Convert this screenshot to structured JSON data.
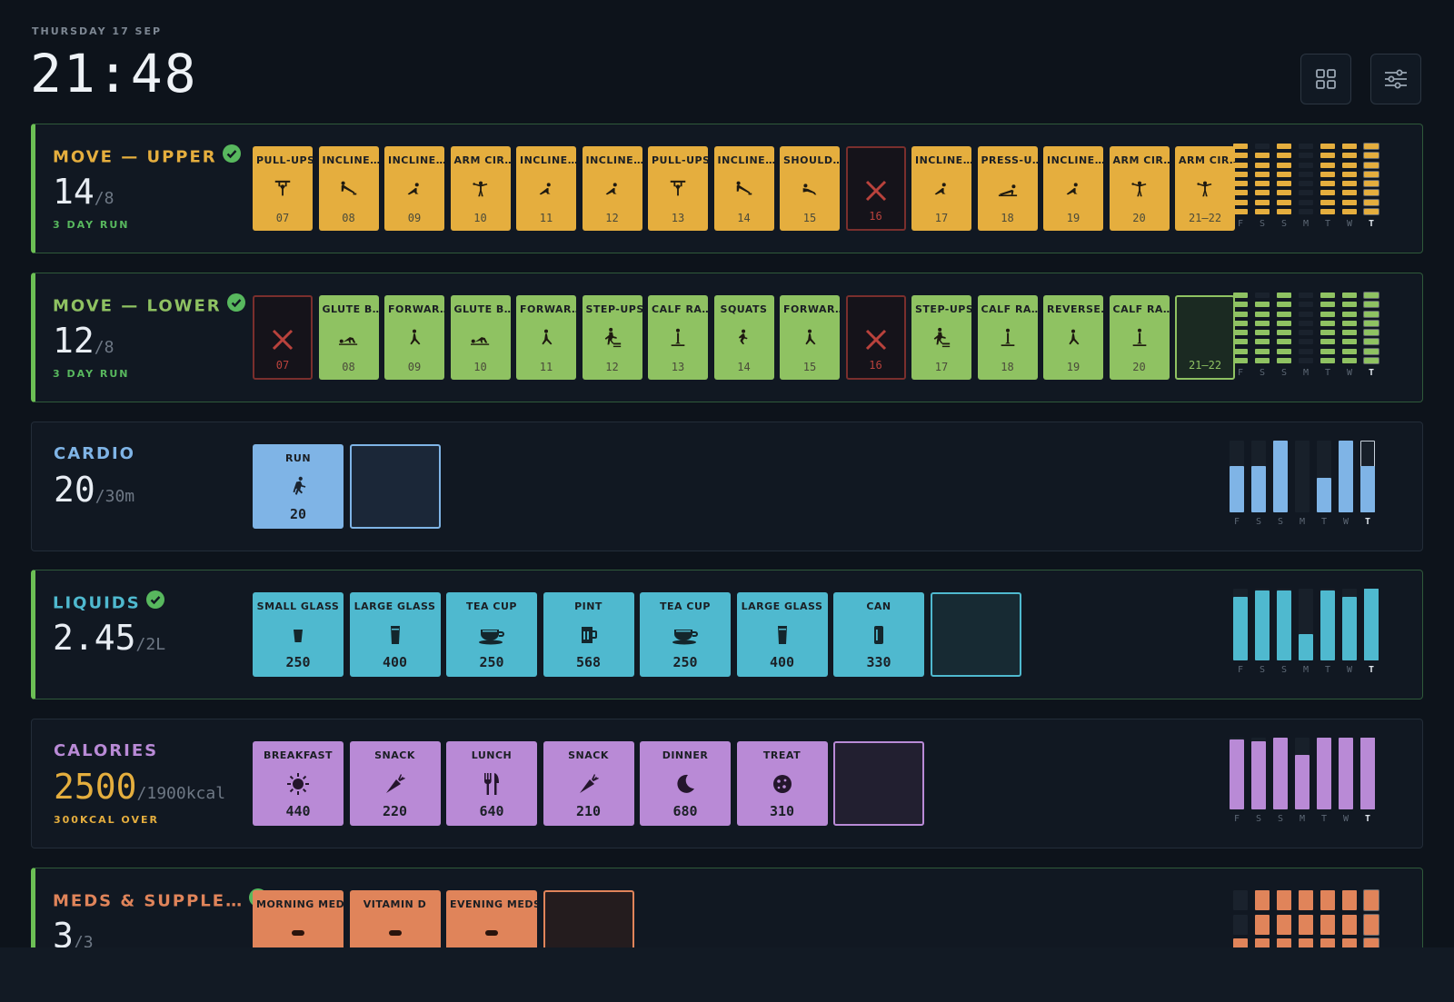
{
  "header": {
    "date": "THURSDAY 17 SEP",
    "time": "21:48"
  },
  "toolbar": {
    "grid_icon": "grid-icon",
    "settings_icon": "sliders-icon"
  },
  "days": [
    "F",
    "S",
    "S",
    "M",
    "T",
    "W",
    "T"
  ],
  "sections": [
    {
      "id": "move-upper",
      "title": "MOVE — UPPER",
      "complete": true,
      "value": "14",
      "goal": "/8",
      "sub": "3 DAY RUN",
      "color": "#e5ae3e",
      "title_color": "#e5ae3e",
      "sub_color": "#58b85e",
      "tiles": [
        {
          "label": "PULL-UPS",
          "icon": "pullup-icon",
          "value": "07"
        },
        {
          "label": "INCLINE…",
          "icon": "incline-pushup-icon",
          "value": "08"
        },
        {
          "label": "INCLINE…",
          "icon": "incline-icon",
          "value": "09"
        },
        {
          "label": "ARM CIR…",
          "icon": "arm-circles-icon",
          "value": "10"
        },
        {
          "label": "INCLINE…",
          "icon": "incline-icon",
          "value": "11"
        },
        {
          "label": "INCLINE…",
          "icon": "incline-icon",
          "value": "12"
        },
        {
          "label": "PULL-UPS",
          "icon": "pullup-icon",
          "value": "13"
        },
        {
          "label": "INCLINE…",
          "icon": "incline-pushup-icon",
          "value": "14"
        },
        {
          "label": "SHOULD…",
          "icon": "shoulder-icon",
          "value": "15"
        },
        {
          "missed": true,
          "value": "16"
        },
        {
          "label": "INCLINE…",
          "icon": "incline-icon",
          "value": "17"
        },
        {
          "label": "PRESS-U…",
          "icon": "pressup-icon",
          "value": "18"
        },
        {
          "label": "INCLINE…",
          "icon": "incline-icon",
          "value": "19"
        },
        {
          "label": "ARM CIR…",
          "icon": "arm-circles-icon",
          "value": "20"
        },
        {
          "label": "ARM CIR…",
          "icon": "arm-circles-icon",
          "value": "21–22"
        }
      ],
      "spark": {
        "type": "segments",
        "max": 8,
        "values": [
          8,
          7,
          8,
          0,
          8,
          8,
          8
        ]
      }
    },
    {
      "id": "move-lower",
      "title": "MOVE — LOWER",
      "complete": true,
      "value": "12",
      "goal": "/8",
      "sub": "3 DAY RUN",
      "color": "#8fc262",
      "title_color": "#8fc262",
      "sub_color": "#58b85e",
      "tiles": [
        {
          "missed": true,
          "value": "07"
        },
        {
          "label": "GLUTE B…",
          "icon": "glute-bridge-icon",
          "value": "08"
        },
        {
          "label": "FORWAR…",
          "icon": "lunge-icon",
          "value": "09"
        },
        {
          "label": "GLUTE B…",
          "icon": "glute-bridge-icon",
          "value": "10"
        },
        {
          "label": "FORWAR…",
          "icon": "lunge-icon",
          "value": "11"
        },
        {
          "label": "STEP-UPS",
          "icon": "step-up-icon",
          "value": "12"
        },
        {
          "label": "CALF RA…",
          "icon": "calf-raise-icon",
          "value": "13"
        },
        {
          "label": "SQUATS",
          "icon": "squat-icon",
          "value": "14"
        },
        {
          "label": "FORWAR…",
          "icon": "lunge-icon",
          "value": "15"
        },
        {
          "missed": true,
          "value": "16"
        },
        {
          "label": "STEP-UPS",
          "icon": "step-up-icon",
          "value": "17"
        },
        {
          "label": "CALF RA…",
          "icon": "calf-raise-icon",
          "value": "18"
        },
        {
          "label": "REVERSE…",
          "icon": "lunge-icon",
          "value": "19"
        },
        {
          "label": "CALF RA…",
          "icon": "calf-raise-icon",
          "value": "20"
        },
        {
          "empty": true,
          "value": "21–22"
        }
      ],
      "spark": {
        "type": "segments",
        "max": 8,
        "values": [
          8,
          7,
          8,
          0,
          8,
          8,
          8
        ]
      }
    },
    {
      "id": "cardio",
      "title": "CARDIO",
      "complete": false,
      "value": "20",
      "goal": "/30m",
      "sub": "",
      "color": "#7fb4e6",
      "title_color": "#7fb4e6",
      "sub_color": "#7fb4e6",
      "tiles": [
        {
          "label": "RUN",
          "icon": "run-icon",
          "value": "20"
        },
        {
          "empty": true,
          "value": ""
        }
      ],
      "spark": {
        "type": "bars",
        "values": [
          0.65,
          0.65,
          1.0,
          0,
          0.48,
          1.0,
          0.65
        ]
      }
    },
    {
      "id": "liquids",
      "title": "LIQUIDS",
      "complete": true,
      "value": "2.45",
      "goal": "/2L",
      "sub": "",
      "color": "#4fb9cf",
      "title_color": "#4fb9cf",
      "sub_color": "#4fb9cf",
      "tiles": [
        {
          "label": "SMALL GLASS",
          "icon": "small-glass-icon",
          "value": "250"
        },
        {
          "label": "LARGE GLASS",
          "icon": "large-glass-icon",
          "value": "400"
        },
        {
          "label": "TEA CUP",
          "icon": "tea-cup-icon",
          "value": "250"
        },
        {
          "label": "PINT",
          "icon": "pint-icon",
          "value": "568"
        },
        {
          "label": "TEA CUP",
          "icon": "tea-cup-icon",
          "value": "250"
        },
        {
          "label": "LARGE GLASS",
          "icon": "large-glass-icon",
          "value": "400"
        },
        {
          "label": "CAN",
          "icon": "can-icon",
          "value": "330"
        },
        {
          "empty": true,
          "value": ""
        }
      ],
      "spark": {
        "type": "bars",
        "values": [
          0.88,
          0.98,
          0.98,
          0.37,
          0.97,
          0.88,
          1.0
        ]
      }
    },
    {
      "id": "calories",
      "title": "CALORIES",
      "complete": false,
      "value": "2500",
      "goal": "/1900kcal",
      "sub": "300KCAL OVER",
      "color": "#b98ad6",
      "title_color": "#b98ad6",
      "sub_color": "#e5ae3e",
      "value_color": "#e5ae3e",
      "tiles": [
        {
          "label": "BREAKFAST",
          "icon": "sun-icon",
          "value": "440"
        },
        {
          "label": "SNACK",
          "icon": "carrot-icon",
          "value": "220"
        },
        {
          "label": "LUNCH",
          "icon": "fork-knife-icon",
          "value": "640"
        },
        {
          "label": "SNACK",
          "icon": "carrot-icon",
          "value": "210"
        },
        {
          "label": "DINNER",
          "icon": "moon-icon",
          "value": "680"
        },
        {
          "label": "TREAT",
          "icon": "cookie-icon",
          "value": "310"
        },
        {
          "empty": true,
          "value": ""
        }
      ],
      "spark": {
        "type": "bars",
        "values": [
          0.98,
          0.95,
          1.0,
          0.76,
          1.0,
          1.0,
          1.0
        ]
      }
    },
    {
      "id": "meds",
      "title": "MEDS & SUPPLE…",
      "complete": true,
      "value": "3",
      "goal": "/3",
      "sub": "",
      "color": "#e0845a",
      "title_color": "#e0845a",
      "sub_color": "#58b85e",
      "tiles": [
        {
          "label": "MORNING MEDS",
          "icon": "pill-icon",
          "value": ""
        },
        {
          "label": "VITAMIN D",
          "icon": "pill-icon",
          "value": ""
        },
        {
          "label": "EVENING MEDS",
          "icon": "pill-icon",
          "value": ""
        },
        {
          "empty": true,
          "value": ""
        }
      ],
      "spark": {
        "type": "segments",
        "max": 3,
        "values": [
          1,
          3,
          3,
          3,
          3,
          3,
          3
        ]
      }
    }
  ]
}
